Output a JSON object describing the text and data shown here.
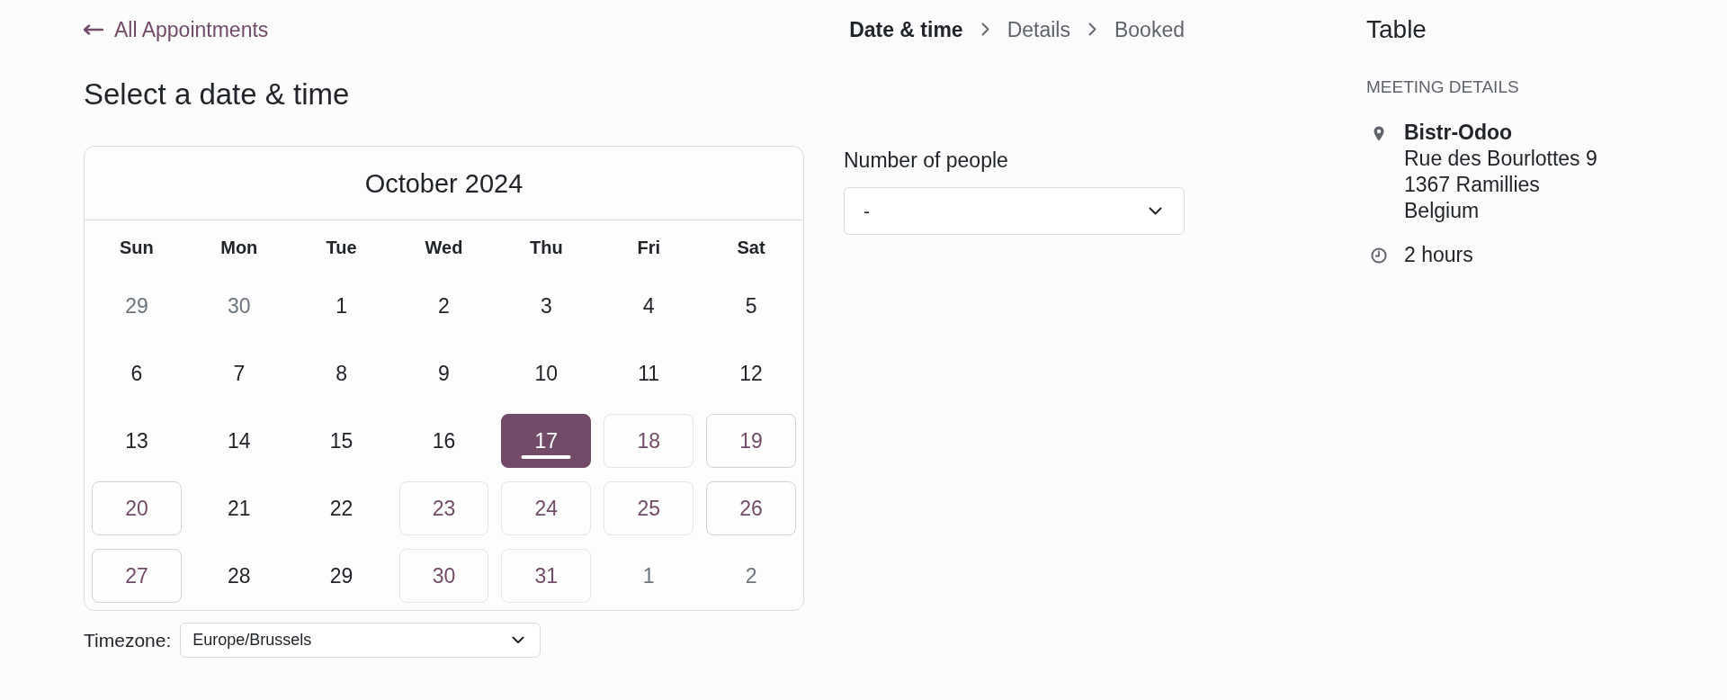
{
  "back_link": {
    "label": "All Appointments"
  },
  "steps": [
    {
      "label": "Date & time",
      "selected": true
    },
    {
      "label": "Details",
      "selected": false
    },
    {
      "label": "Booked",
      "selected": false
    }
  ],
  "heading": "Select a date & time",
  "calendar": {
    "title": "October 2024",
    "weekdays": [
      "Sun",
      "Mon",
      "Tue",
      "Wed",
      "Thu",
      "Fri",
      "Sat"
    ],
    "weeks": [
      [
        {
          "day": "29",
          "kind": "outside",
          "selected": false
        },
        {
          "day": "30",
          "kind": "outside",
          "selected": false
        },
        {
          "day": "1",
          "kind": "unavailable",
          "selected": false
        },
        {
          "day": "2",
          "kind": "unavailable",
          "selected": false
        },
        {
          "day": "3",
          "kind": "unavailable",
          "selected": false
        },
        {
          "day": "4",
          "kind": "unavailable",
          "selected": false
        },
        {
          "day": "5",
          "kind": "unavailable",
          "selected": false
        }
      ],
      [
        {
          "day": "6",
          "kind": "unavailable",
          "selected": false
        },
        {
          "day": "7",
          "kind": "unavailable",
          "selected": false
        },
        {
          "day": "8",
          "kind": "unavailable",
          "selected": false
        },
        {
          "day": "9",
          "kind": "unavailable",
          "selected": false
        },
        {
          "day": "10",
          "kind": "unavailable",
          "selected": false
        },
        {
          "day": "11",
          "kind": "unavailable",
          "selected": false
        },
        {
          "day": "12",
          "kind": "unavailable",
          "selected": false
        }
      ],
      [
        {
          "day": "13",
          "kind": "unavailable",
          "selected": false
        },
        {
          "day": "14",
          "kind": "unavailable",
          "selected": false
        },
        {
          "day": "15",
          "kind": "unavailable",
          "selected": false
        },
        {
          "day": "16",
          "kind": "unavailable",
          "selected": false
        },
        {
          "day": "17",
          "kind": "available",
          "selected": true
        },
        {
          "day": "18",
          "kind": "available",
          "selected": false
        },
        {
          "day": "19",
          "kind": "available",
          "selected": false
        }
      ],
      [
        {
          "day": "20",
          "kind": "available",
          "selected": false
        },
        {
          "day": "21",
          "kind": "unavailable",
          "selected": false
        },
        {
          "day": "22",
          "kind": "unavailable",
          "selected": false
        },
        {
          "day": "23",
          "kind": "available",
          "selected": false
        },
        {
          "day": "24",
          "kind": "available",
          "selected": false
        },
        {
          "day": "25",
          "kind": "available",
          "selected": false
        },
        {
          "day": "26",
          "kind": "available",
          "selected": false
        }
      ],
      [
        {
          "day": "27",
          "kind": "available",
          "selected": false
        },
        {
          "day": "28",
          "kind": "unavailable",
          "selected": false
        },
        {
          "day": "29",
          "kind": "unavailable",
          "selected": false
        },
        {
          "day": "30",
          "kind": "available",
          "selected": false
        },
        {
          "day": "31",
          "kind": "available",
          "selected": false
        },
        {
          "day": "1",
          "kind": "outside",
          "selected": false
        },
        {
          "day": "2",
          "kind": "outside",
          "selected": false
        }
      ]
    ]
  },
  "timezone": {
    "label": "Timezone:",
    "value": "Europe/Brussels"
  },
  "people": {
    "label": "Number of people",
    "value": "-"
  },
  "sidebar": {
    "title": "Table",
    "section": "MEETING DETAILS",
    "location": {
      "name": "Bistr-Odoo",
      "address_lines": [
        "Rue des Bourlottes 9",
        "1367 Ramillies",
        "Belgium"
      ]
    },
    "duration": "2 hours"
  }
}
